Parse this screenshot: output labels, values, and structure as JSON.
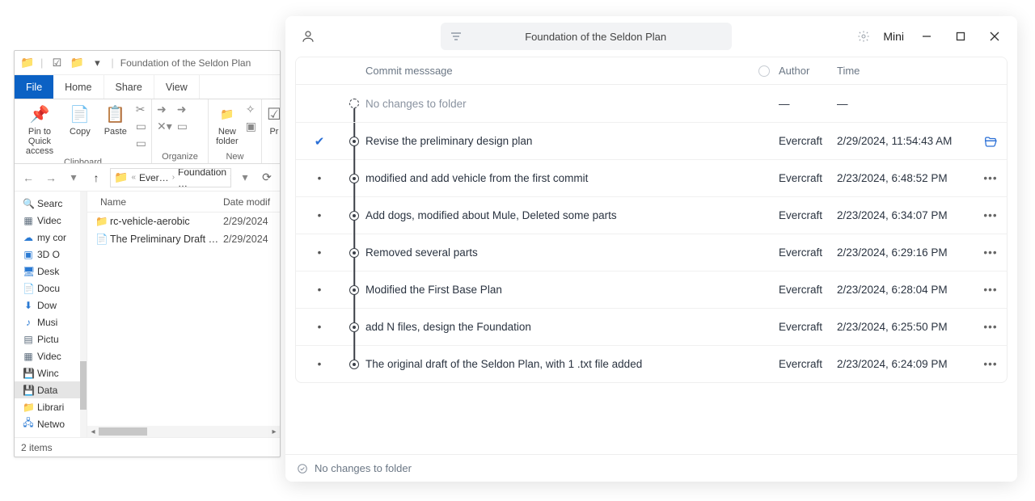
{
  "explorer": {
    "title": "Foundation of the Seldon Plan",
    "tabs": {
      "file": "File",
      "home": "Home",
      "share": "Share",
      "view": "View"
    },
    "ribbon": {
      "pin": "Pin to Quick access",
      "copy": "Copy",
      "paste": "Paste",
      "newFolder": "New folder",
      "propsAbbr": "Pr",
      "groups": {
        "clipboard": "Clipboard",
        "organize": "Organize",
        "new": "New"
      }
    },
    "crumbs": {
      "seg1": "Ever…",
      "seg2": "Foundation …"
    },
    "tree": [
      {
        "label": "Searc",
        "icon": "🔍",
        "cls": "ti-yellow"
      },
      {
        "label": "Videc",
        "icon": "▦",
        "cls": "ti-mono"
      },
      {
        "label": "my cor",
        "icon": "☁",
        "cls": "ti-blue"
      },
      {
        "label": "3D O",
        "icon": "▣",
        "cls": "ti-blue"
      },
      {
        "label": "Desk",
        "icon": "🖥",
        "cls": "ti-blue"
      },
      {
        "label": "Docu",
        "icon": "📄",
        "cls": "ti-mono"
      },
      {
        "label": "Dow",
        "icon": "⬇",
        "cls": "ti-blue"
      },
      {
        "label": "Musi",
        "icon": "♪",
        "cls": "ti-blue"
      },
      {
        "label": "Pictu",
        "icon": "▤",
        "cls": "ti-mono"
      },
      {
        "label": "Videc",
        "icon": "▦",
        "cls": "ti-mono"
      },
      {
        "label": "Winc",
        "icon": "💾",
        "cls": "ti-mono"
      },
      {
        "label": "Data",
        "icon": "💾",
        "cls": "ti-mono",
        "selected": true
      },
      {
        "label": "Librari",
        "icon": "📁",
        "cls": "ti-yellow"
      },
      {
        "label": "Netwo",
        "icon": "🖧",
        "cls": "ti-blue"
      }
    ],
    "columns": {
      "name": "Name",
      "date": "Date modif"
    },
    "files": [
      {
        "icon": "📁",
        "name": "rc-vehicle-aerobic",
        "date": "2/29/2024"
      },
      {
        "icon": "📄",
        "name": "The Preliminary Draft of…",
        "date": "2/29/2024"
      }
    ],
    "status": "2 items"
  },
  "vc": {
    "title": "Foundation of the Seldon Plan",
    "mini": "Mini",
    "headers": {
      "msg": "Commit messsage",
      "author": "Author",
      "time": "Time"
    },
    "rows": [
      {
        "sel": "",
        "nodeTop": false,
        "nodeBot": true,
        "dotted": true,
        "inner": false,
        "msg": "No changes to folder",
        "author": "—",
        "time": "—",
        "action": "",
        "nochange": true
      },
      {
        "sel": "check",
        "nodeTop": true,
        "nodeBot": true,
        "dotted": false,
        "inner": true,
        "msg": "Revise the preliminary design plan",
        "author": "Evercraft",
        "time": "2/29/2024, 11:54:43 AM",
        "action": "open"
      },
      {
        "sel": "dot",
        "nodeTop": true,
        "nodeBot": true,
        "dotted": false,
        "inner": true,
        "msg": "modified and add vehicle from the first commit",
        "author": "Evercraft",
        "time": "2/23/2024, 6:48:52 PM",
        "action": "more"
      },
      {
        "sel": "dot",
        "nodeTop": true,
        "nodeBot": true,
        "dotted": false,
        "inner": true,
        "msg": "Add dogs, modified about Mule, Deleted some parts",
        "author": "Evercraft",
        "time": "2/23/2024, 6:34:07 PM",
        "action": "more"
      },
      {
        "sel": "dot",
        "nodeTop": true,
        "nodeBot": true,
        "dotted": false,
        "inner": true,
        "msg": "Removed several parts",
        "author": "Evercraft",
        "time": "2/23/2024, 6:29:16 PM",
        "action": "more"
      },
      {
        "sel": "dot",
        "nodeTop": true,
        "nodeBot": true,
        "dotted": false,
        "inner": true,
        "msg": "Modified the First Base Plan",
        "author": "Evercraft",
        "time": "2/23/2024, 6:28:04 PM",
        "action": "more"
      },
      {
        "sel": "dot",
        "nodeTop": true,
        "nodeBot": true,
        "dotted": false,
        "inner": true,
        "msg": "add N files, design the Foundation",
        "author": "Evercraft",
        "time": "2/23/2024, 6:25:50 PM",
        "action": "more"
      },
      {
        "sel": "dot",
        "nodeTop": true,
        "nodeBot": false,
        "dotted": false,
        "inner": true,
        "msg": "The original draft of the Seldon Plan, with 1 .txt file added",
        "author": "Evercraft",
        "time": "2/23/2024, 6:24:09 PM",
        "action": "more"
      }
    ],
    "status": "No changes to folder"
  }
}
